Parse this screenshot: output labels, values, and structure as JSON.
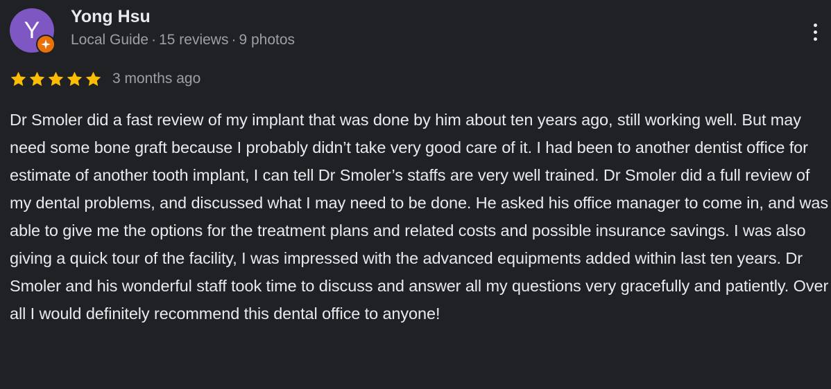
{
  "reviewer": {
    "initial": "Y",
    "name": "Yong Hsu",
    "badge": "Local Guide",
    "reviews": "15 reviews",
    "photos": "9 photos",
    "avatar_color": "#7e57c2",
    "badge_color": "#e8710a"
  },
  "review": {
    "rating": 5,
    "max_rating": 5,
    "star_color": "#fbbc04",
    "date": "3 months ago",
    "text": "Dr Smoler did a fast review of my implant that was done by him about ten years ago, still working well. But may need some bone graft because I probably didn’t take very good care of it. I had been to another dentist office for estimate of another tooth implant, I can tell Dr Smoler’s staffs are very well trained. Dr Smoler did a full review of my dental problems, and discussed what I may need to be done. He asked his office manager to come in, and was able to give me the options for the treatment plans and related costs and possible insurance savings. I was also giving a quick tour of the facility, I was impressed with the advanced equipments added within last ten years. Dr Smoler and his wonderful staff took time to discuss and answer all my questions very gracefully and patiently. Over all I would definitely recommend this dental office to anyone!"
  },
  "icons": {
    "more": "more-vert-icon",
    "star": "star-icon",
    "local_guide": "local-guide-badge-icon"
  }
}
